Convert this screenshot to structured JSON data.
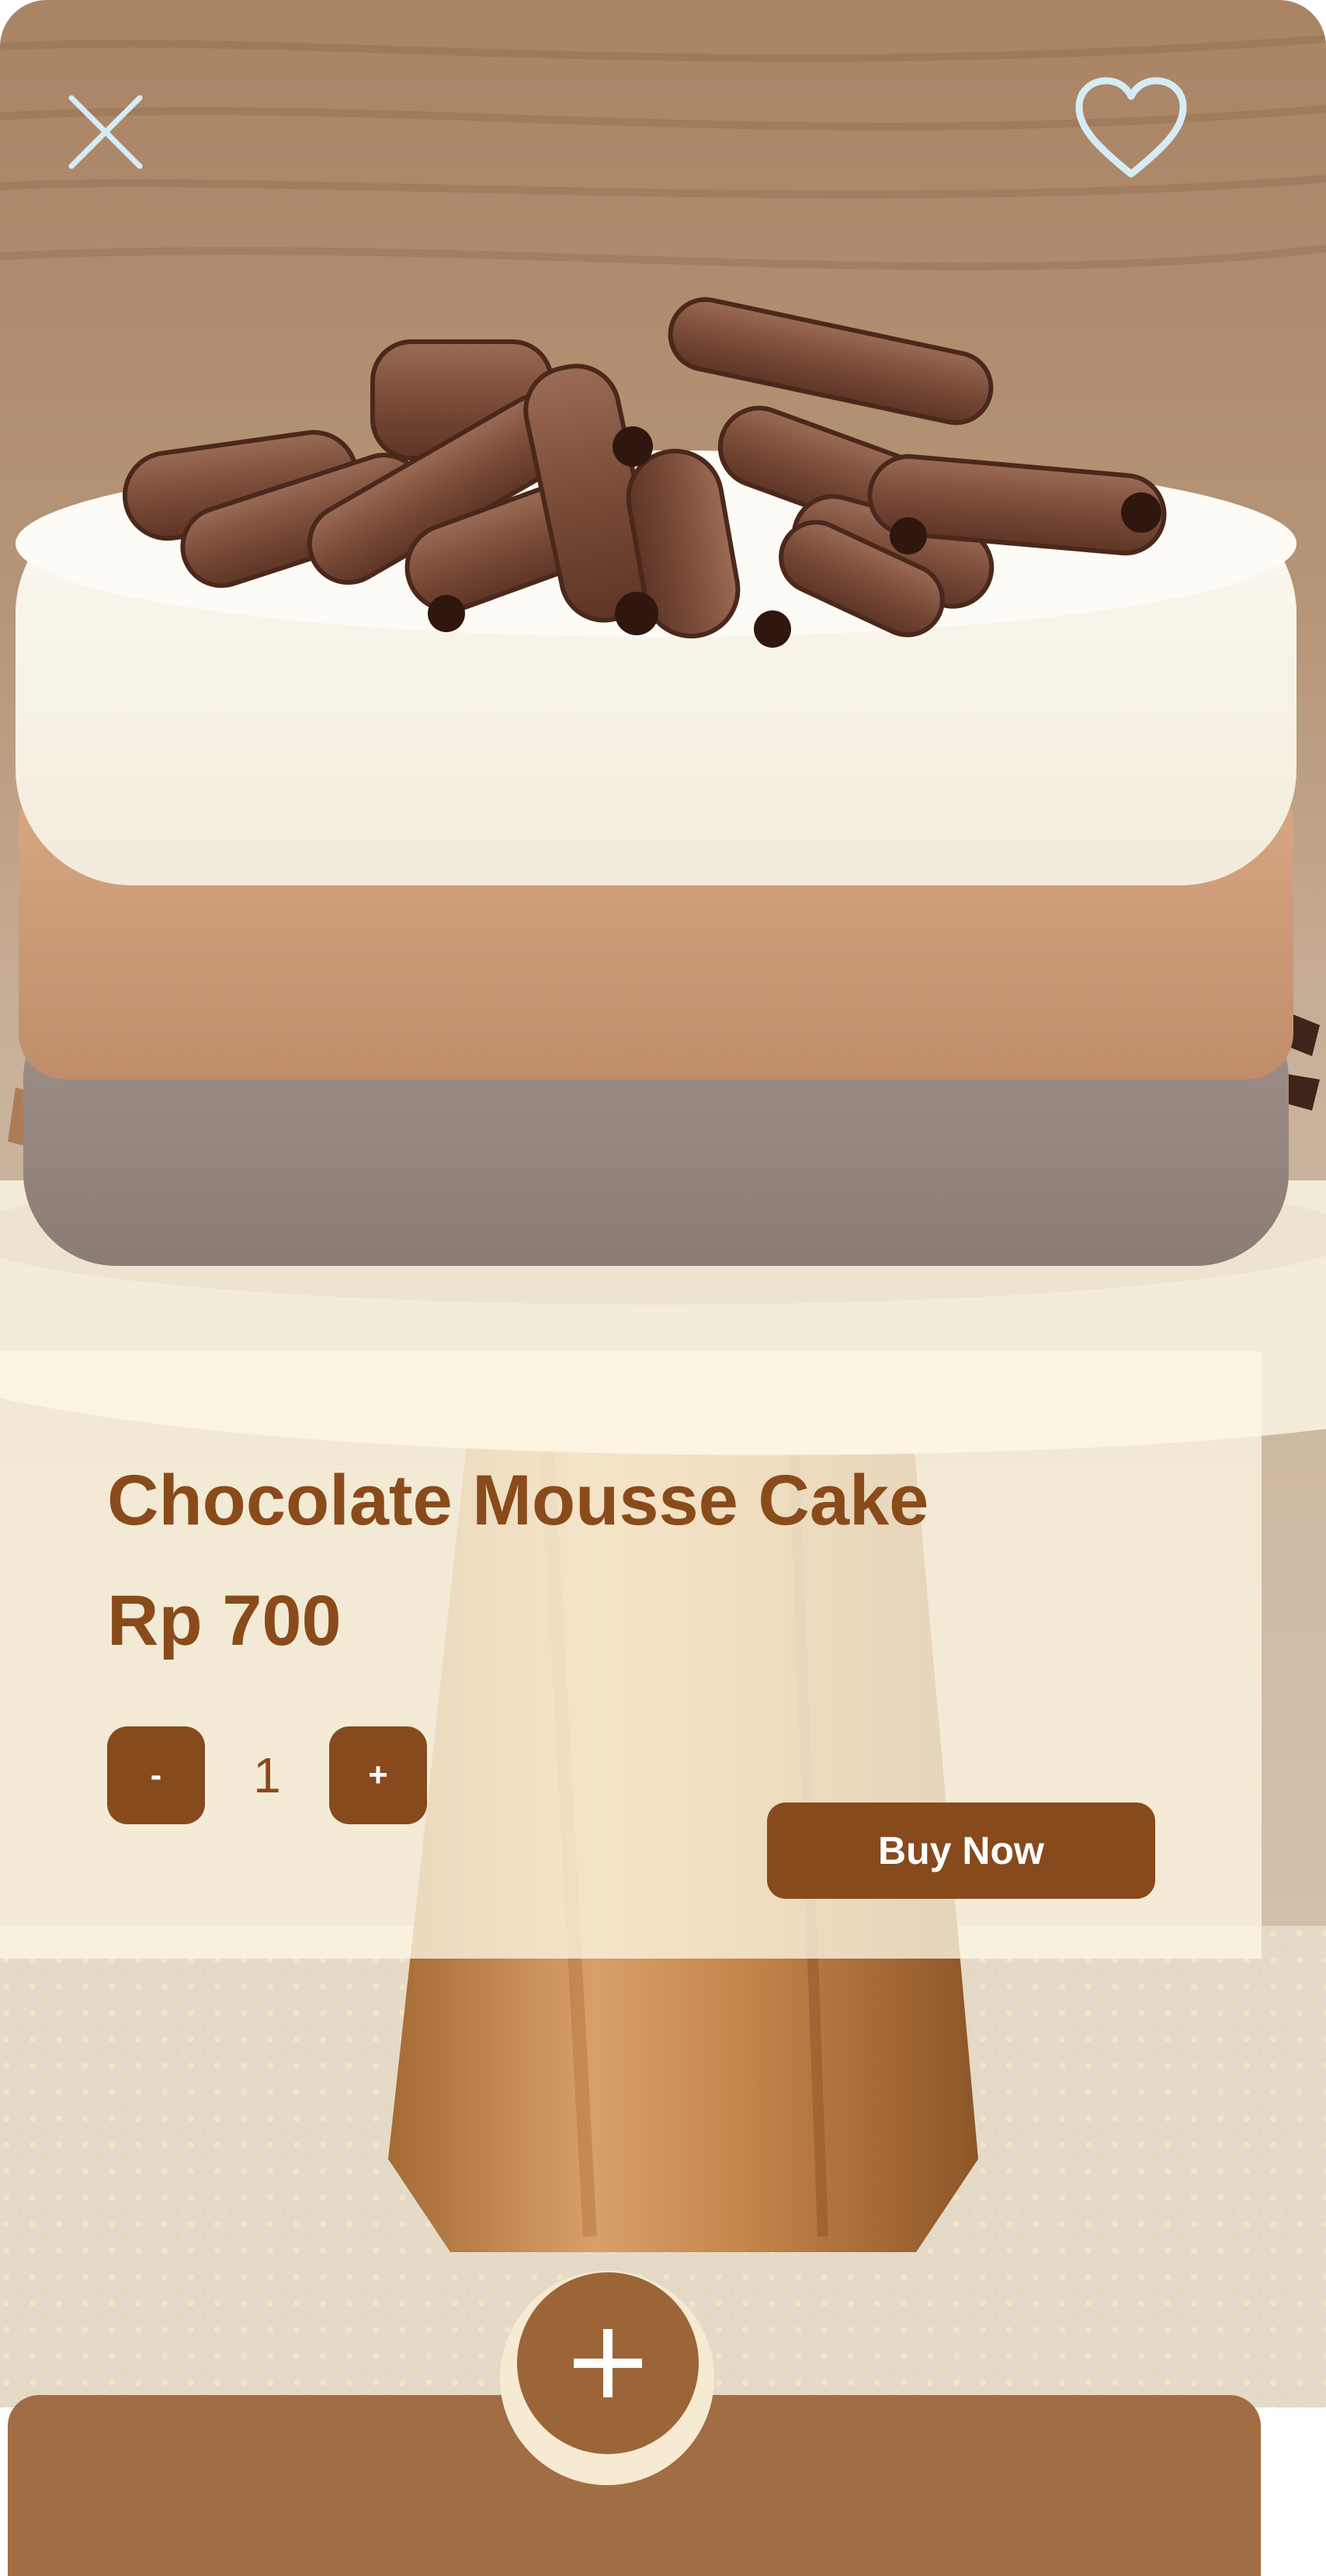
{
  "product": {
    "name": "Chocolate Mousse Cake",
    "price": "Rp 700"
  },
  "quantity": {
    "minus_label": "-",
    "value": "1",
    "plus_label": "+"
  },
  "actions": {
    "buy_label": "Buy Now"
  },
  "icons": {
    "close": "close-icon",
    "favorite": "heart-outline-icon",
    "add": "plus-icon"
  },
  "colors": {
    "brand_brown": "#874a1d",
    "title_brown": "#8a4b1b",
    "bottom_bar": "#a16d44",
    "card_cream": "#fdf7e3",
    "icon_light_blue": "#d6ecf5"
  }
}
